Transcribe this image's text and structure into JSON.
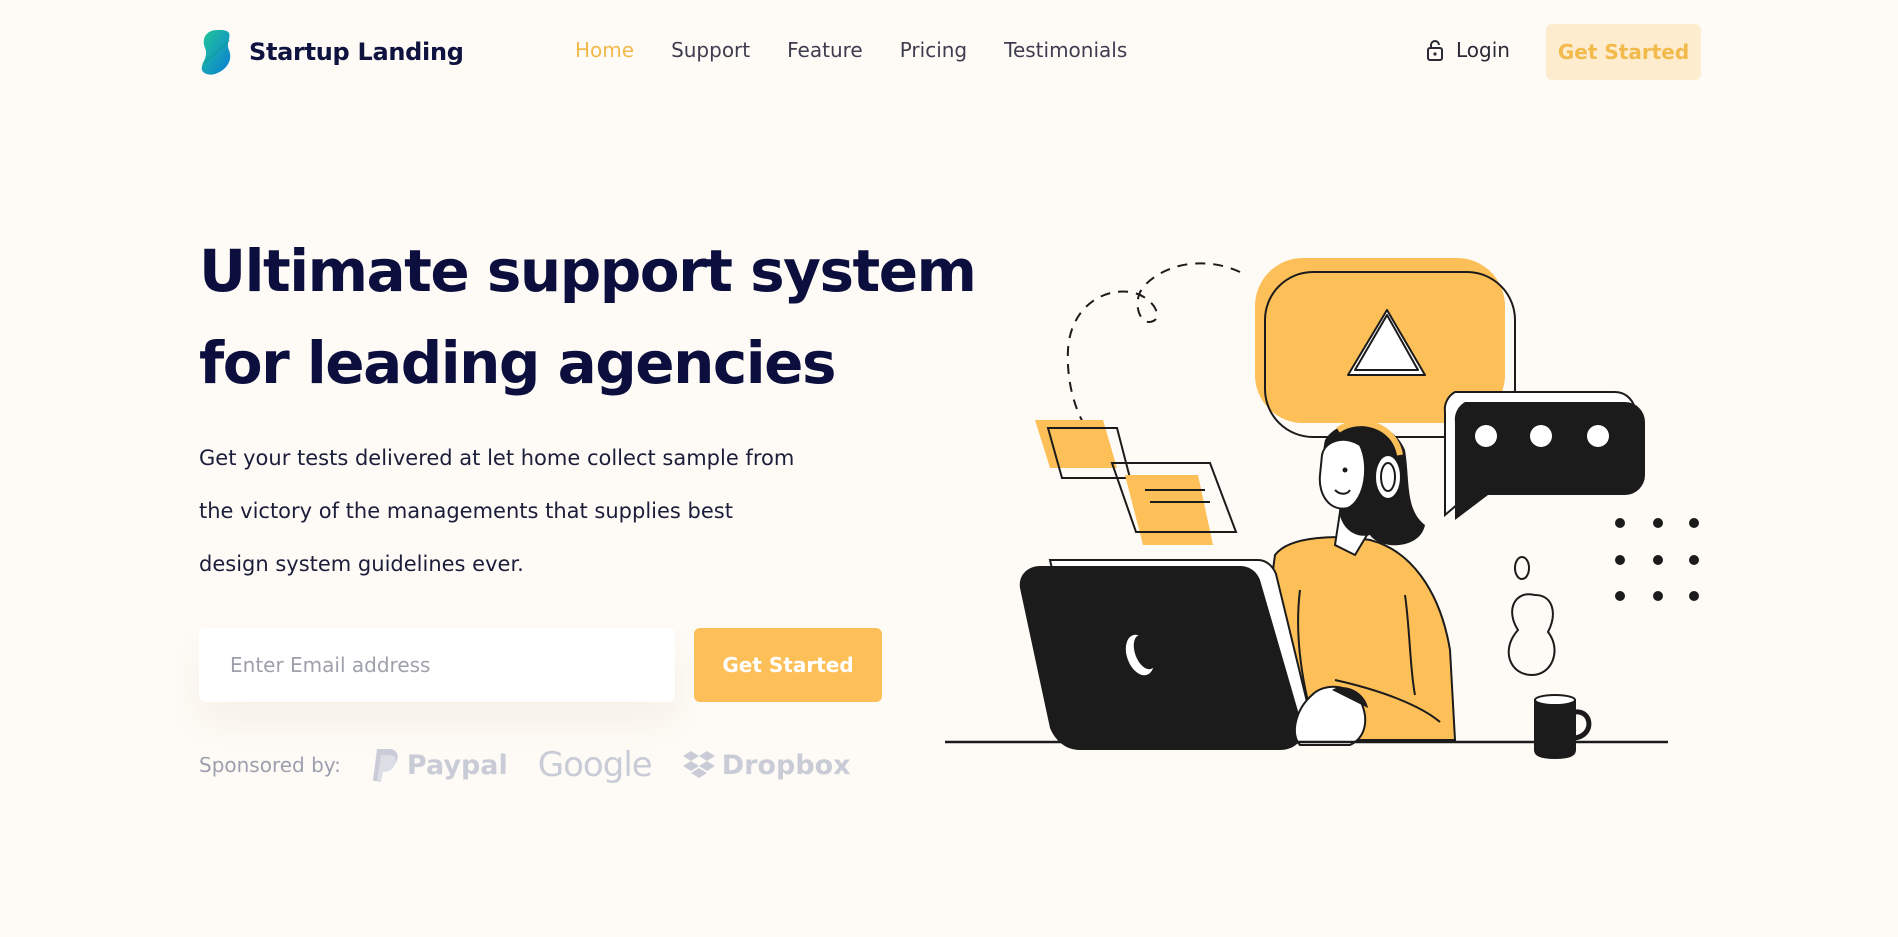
{
  "brand": {
    "name": "Startup Landing",
    "logo_icon": "leaf-logo-icon"
  },
  "nav": {
    "items": [
      {
        "label": "Home",
        "active": true
      },
      {
        "label": "Support",
        "active": false
      },
      {
        "label": "Feature",
        "active": false
      },
      {
        "label": "Pricing",
        "active": false
      },
      {
        "label": "Testimonials",
        "active": false
      }
    ]
  },
  "header": {
    "login_label": "Login",
    "login_icon": "lock-icon",
    "cta_label": "Get Started"
  },
  "hero": {
    "title_lines": [
      "Ultimate support system",
      "for leading agencies"
    ],
    "description_lines": [
      "Get your tests delivered at let home collect sample from",
      "the victory of the managements that supplies best",
      "design system guidelines ever."
    ],
    "email": {
      "placeholder": "Enter Email address",
      "value": ""
    },
    "cta_label": "Get Started"
  },
  "sponsors": {
    "label": "Sponsored by:",
    "brands": [
      "Paypal",
      "Google",
      "Dropbox"
    ]
  },
  "colors": {
    "background": "#fefbf6",
    "accent": "#fdbf58",
    "accent_text": "#f2b94b",
    "accent_soft": "#fdeccd",
    "heading": "#0c0f3d",
    "muted": "#9ca0ae"
  }
}
